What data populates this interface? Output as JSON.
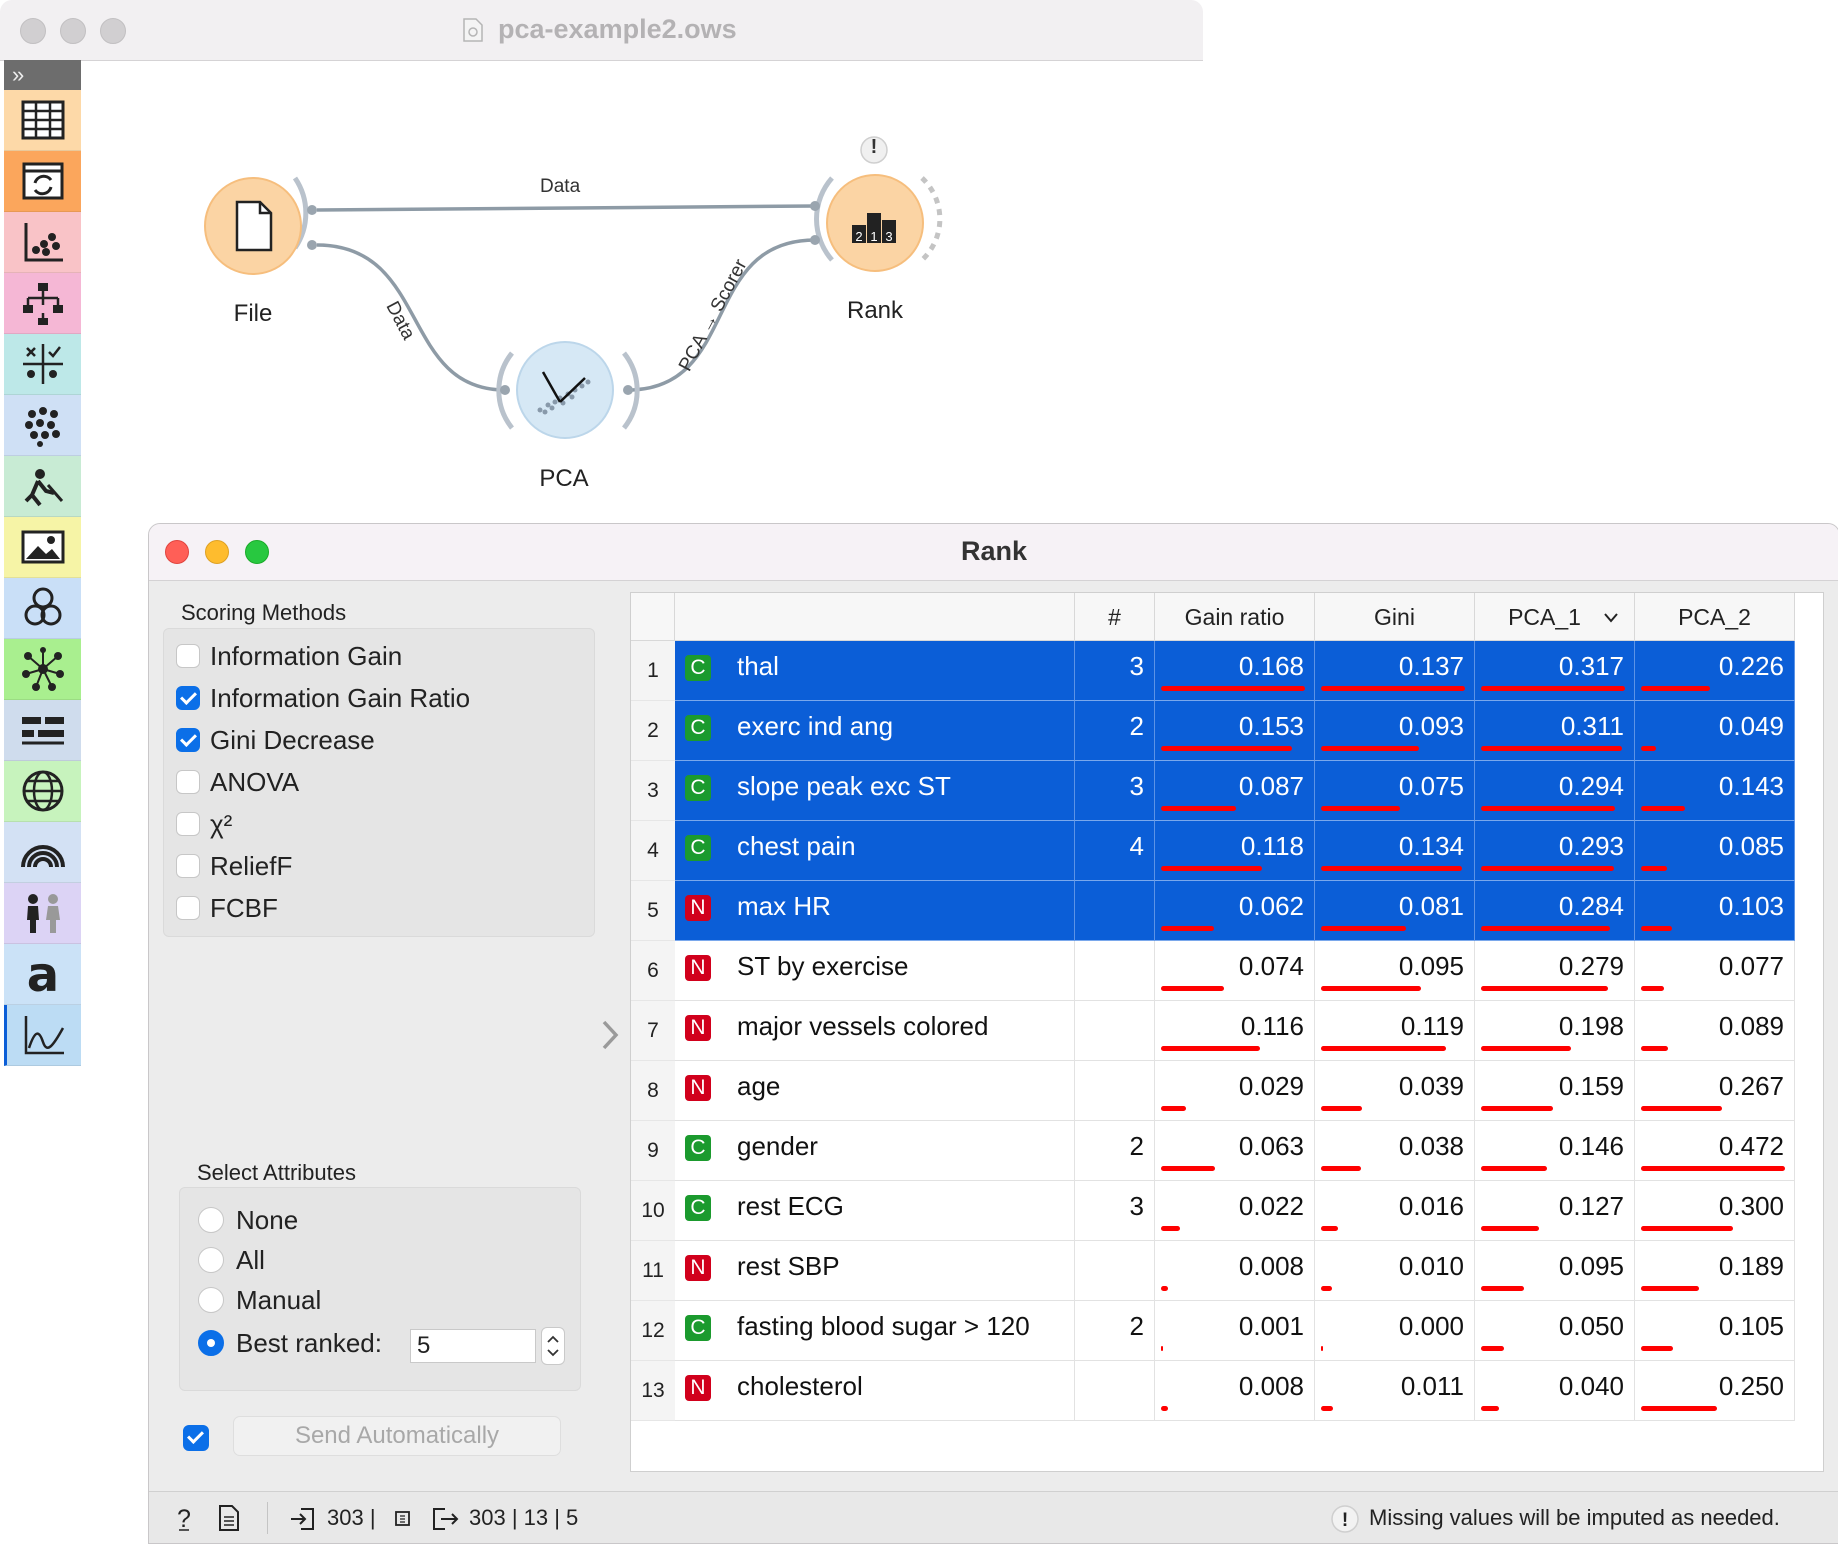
{
  "main_window": {
    "title": "pca-example2.ows"
  },
  "workflow": {
    "nodes": {
      "file": "File",
      "pca": "PCA",
      "rank": "Rank"
    },
    "links": {
      "file_rank": "Data",
      "file_pca": "Data",
      "pca_rank": "PCA → Scorer"
    },
    "rank_warning": "!"
  },
  "toolbox": {
    "categories": [
      "data-icon",
      "transform-icon",
      "visualize-icon",
      "model-icon",
      "evaluate-icon",
      "unsupervised-icon",
      "educational-icon",
      "image-analytics-icon",
      "bioinformatics-icon",
      "network-icon",
      "text-mining-icon",
      "geo-icon",
      "spectroscopy-icon",
      "survival-icon",
      "text-icon",
      "timeseries-icon"
    ],
    "colors": [
      "#fdd9a8",
      "#fba65c",
      "#f9c3c7",
      "#f5b7d5",
      "#bde8e8",
      "#cfe0f5",
      "#c8ebd4",
      "#f6f4a6",
      "#c9dff7",
      "#a9ef8f",
      "#cfdced",
      "#c7f3bd",
      "#d3e1f4",
      "#dcd3f5",
      "#cbe2f7",
      "#bcdcf4"
    ]
  },
  "rank": {
    "title": "Rank",
    "scoring": {
      "title": "Scoring Methods",
      "methods": [
        {
          "label": "Information Gain",
          "checked": false
        },
        {
          "label": "Information Gain Ratio",
          "checked": true
        },
        {
          "label": "Gini Decrease",
          "checked": true
        },
        {
          "label": "ANOVA",
          "checked": false
        },
        {
          "label": "χ²",
          "checked": false
        },
        {
          "label": "ReliefF",
          "checked": false
        },
        {
          "label": "FCBF",
          "checked": false
        }
      ]
    },
    "select": {
      "title": "Select Attributes",
      "options": [
        "None",
        "All",
        "Manual",
        "Best ranked:"
      ],
      "selected": "Best ranked:",
      "best_value": "5"
    },
    "send": {
      "label": "Send Automatically",
      "auto_checked": true
    },
    "table": {
      "headers": [
        "",
        "#",
        "Gain ratio",
        "Gini",
        "PCA_1",
        "PCA_2"
      ],
      "sort_indicator": "chevron-down-icon",
      "max": {
        "gain": 0.168,
        "gini": 0.137,
        "pca1": 0.317,
        "pca2": 0.472
      },
      "rows": [
        {
          "n": "1",
          "type": "C",
          "name": "thal",
          "count": "3",
          "gain": "0.168",
          "gini": "0.137",
          "pca1": "0.317",
          "pca2": "0.226",
          "selected": true
        },
        {
          "n": "2",
          "type": "C",
          "name": "exerc ind ang",
          "count": "2",
          "gain": "0.153",
          "gini": "0.093",
          "pca1": "0.311",
          "pca2": "0.049",
          "selected": true
        },
        {
          "n": "3",
          "type": "C",
          "name": "slope peak exc ST",
          "count": "3",
          "gain": "0.087",
          "gini": "0.075",
          "pca1": "0.294",
          "pca2": "0.143",
          "selected": true
        },
        {
          "n": "4",
          "type": "C",
          "name": "chest pain",
          "count": "4",
          "gain": "0.118",
          "gini": "0.134",
          "pca1": "0.293",
          "pca2": "0.085",
          "selected": true
        },
        {
          "n": "5",
          "type": "N",
          "name": "max HR",
          "count": "",
          "gain": "0.062",
          "gini": "0.081",
          "pca1": "0.284",
          "pca2": "0.103",
          "selected": true
        },
        {
          "n": "6",
          "type": "N",
          "name": "ST by exercise",
          "count": "",
          "gain": "0.074",
          "gini": "0.095",
          "pca1": "0.279",
          "pca2": "0.077",
          "selected": false
        },
        {
          "n": "7",
          "type": "N",
          "name": "major vessels colored",
          "count": "",
          "gain": "0.116",
          "gini": "0.119",
          "pca1": "0.198",
          "pca2": "0.089",
          "selected": false
        },
        {
          "n": "8",
          "type": "N",
          "name": "age",
          "count": "",
          "gain": "0.029",
          "gini": "0.039",
          "pca1": "0.159",
          "pca2": "0.267",
          "selected": false
        },
        {
          "n": "9",
          "type": "C",
          "name": "gender",
          "count": "2",
          "gain": "0.063",
          "gini": "0.038",
          "pca1": "0.146",
          "pca2": "0.472",
          "selected": false
        },
        {
          "n": "10",
          "type": "C",
          "name": "rest ECG",
          "count": "3",
          "gain": "0.022",
          "gini": "0.016",
          "pca1": "0.127",
          "pca2": "0.300",
          "selected": false
        },
        {
          "n": "11",
          "type": "N",
          "name": "rest SBP",
          "count": "",
          "gain": "0.008",
          "gini": "0.010",
          "pca1": "0.095",
          "pca2": "0.189",
          "selected": false
        },
        {
          "n": "12",
          "type": "C",
          "name": "fasting blood sugar > 120",
          "count": "2",
          "gain": "0.001",
          "gini": "0.000",
          "pca1": "0.050",
          "pca2": "0.105",
          "selected": false
        },
        {
          "n": "13",
          "type": "N",
          "name": "cholesterol",
          "count": "",
          "gain": "0.008",
          "gini": "0.011",
          "pca1": "0.040",
          "pca2": "0.250",
          "selected": false
        }
      ]
    },
    "status": {
      "input": "303 |",
      "output": "303 | 13 | 5",
      "message": "Missing values will be imputed as needed."
    }
  }
}
